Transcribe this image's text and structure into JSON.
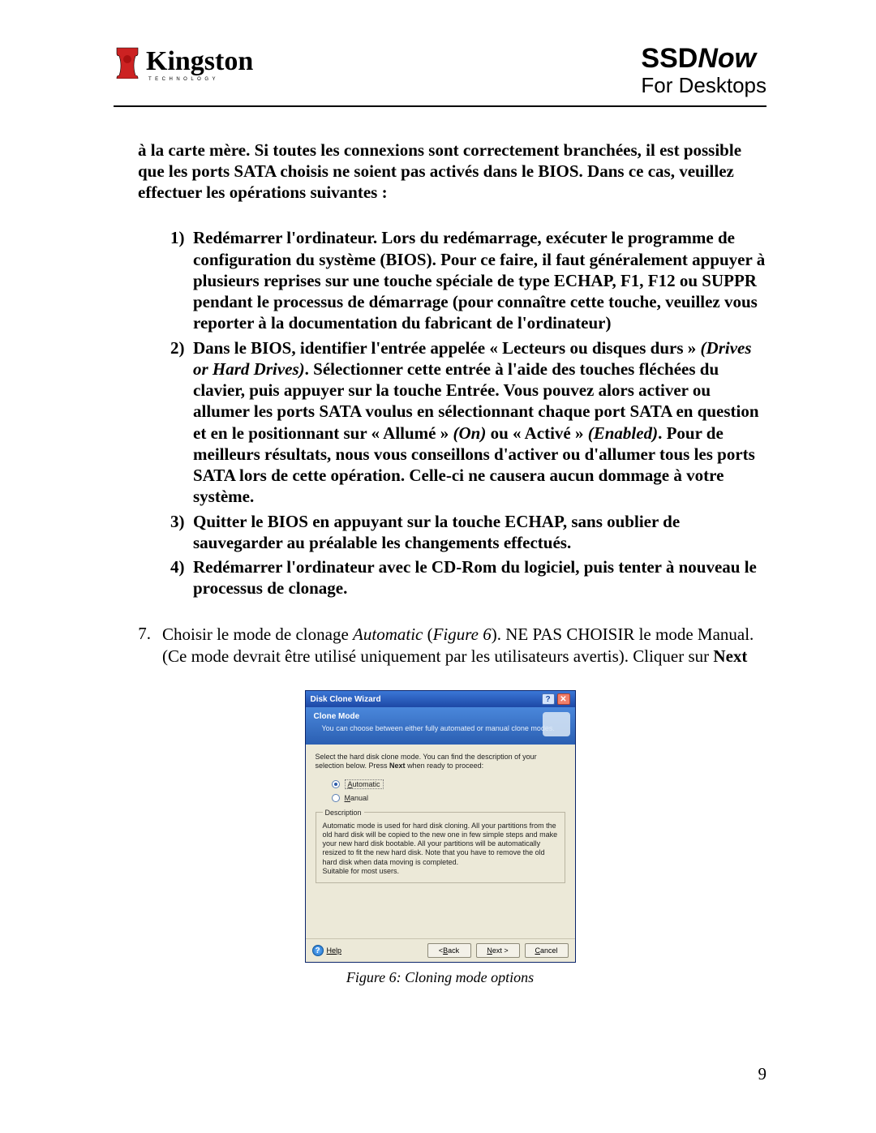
{
  "brand": {
    "name": "Kingston",
    "tagline": "TECHNOLOGY"
  },
  "title": {
    "ssd": "SSD",
    "now": "Now",
    "sub": "For Desktops"
  },
  "intro": "à la carte mère. Si toutes les connexions sont correctement branchées, il est possible que les ports SATA choisis ne soient pas activés dans le BIOS. Dans ce cas, veuillez effectuer les opérations suivantes :",
  "list": {
    "m1": "1)",
    "i1": "Redémarrer l'ordinateur. Lors du redémarrage, exécuter le programme de configuration du système (BIOS). Pour ce faire, il faut généralement appuyer à plusieurs reprises sur une touche spéciale de type ECHAP, F1, F12 ou SUPPR pendant le processus de démarrage (pour connaître cette touche, veuillez vous reporter à la documentation du fabricant de l'ordinateur)",
    "m2": "2)",
    "i2a": "Dans le BIOS, identifier l'entrée appelée « Lecteurs ou disques durs » ",
    "i2b": "(Drives or Hard Drives)",
    "i2c": ". Sélectionner cette entrée à l'aide des touches fléchées du clavier, puis appuyer sur la touche Entrée. Vous pouvez alors activer ou allumer les ports SATA voulus en sélectionnant chaque port SATA en question et en le positionnant sur « Allumé » ",
    "i2d": "(On)",
    "i2e": " ou « Activé » ",
    "i2f": "(Enabled)",
    "i2g": ". Pour de meilleurs résultats, nous vous conseillons d'activer ou d'allumer tous les ports SATA lors de cette opération. Celle-ci ne causera aucun dommage à votre système.",
    "m3": "3)",
    "i3": "Quitter le BIOS en appuyant sur la touche ECHAP, sans oublier de sauvegarder au préalable les changements effectués.",
    "m4": "4)",
    "i4": "Redémarrer l'ordinateur avec le CD-Rom du logiciel, puis tenter à nouveau le processus de clonage."
  },
  "step7": {
    "marker": "7.",
    "pre": "Choisir le mode de clonage ",
    "ital1": "Automatic",
    "mid1": " (",
    "ital2": "Figure 6",
    "mid2": "). NE PAS CHOISIR le mode Manual. (Ce mode devrait être utilisé uniquement par les utilisateurs avertis). Cliquer sur ",
    "next_bold": "Next"
  },
  "wizard": {
    "title": "Disk Clone Wizard",
    "help_glyph": "?",
    "close_glyph": "✕",
    "head_title": "Clone Mode",
    "head_sub": "You can choose between either fully automated or manual clone modes.",
    "body_intro_a": "Select the hard disk clone mode. You can find the description of your selection below. Press ",
    "body_intro_b": "Next",
    "body_intro_c": " when ready to proceed:",
    "opt_auto_u": "A",
    "opt_auto_rest": "utomatic",
    "opt_manual_u": "M",
    "opt_manual_rest": "anual",
    "desc_legend": "Description",
    "desc_text": "Automatic mode is used for hard disk cloning. All your partitions from the old hard disk will be copied to the new one in few simple steps and make your new hard disk bootable. All your partitions will be automatically resized to fit the new hard disk. Note that you have to remove the old hard disk when data moving is completed.\nSuitable for most users.",
    "help_u": "H",
    "help_rest": "elp",
    "btn_back_lt": "< ",
    "btn_back_u": "B",
    "btn_back_rest": "ack",
    "btn_next_u": "N",
    "btn_next_rest": "ext >",
    "btn_cancel_u": "C",
    "btn_cancel_rest": "ancel"
  },
  "figure_caption": "Figure 6: Cloning mode options",
  "page_number": "9"
}
